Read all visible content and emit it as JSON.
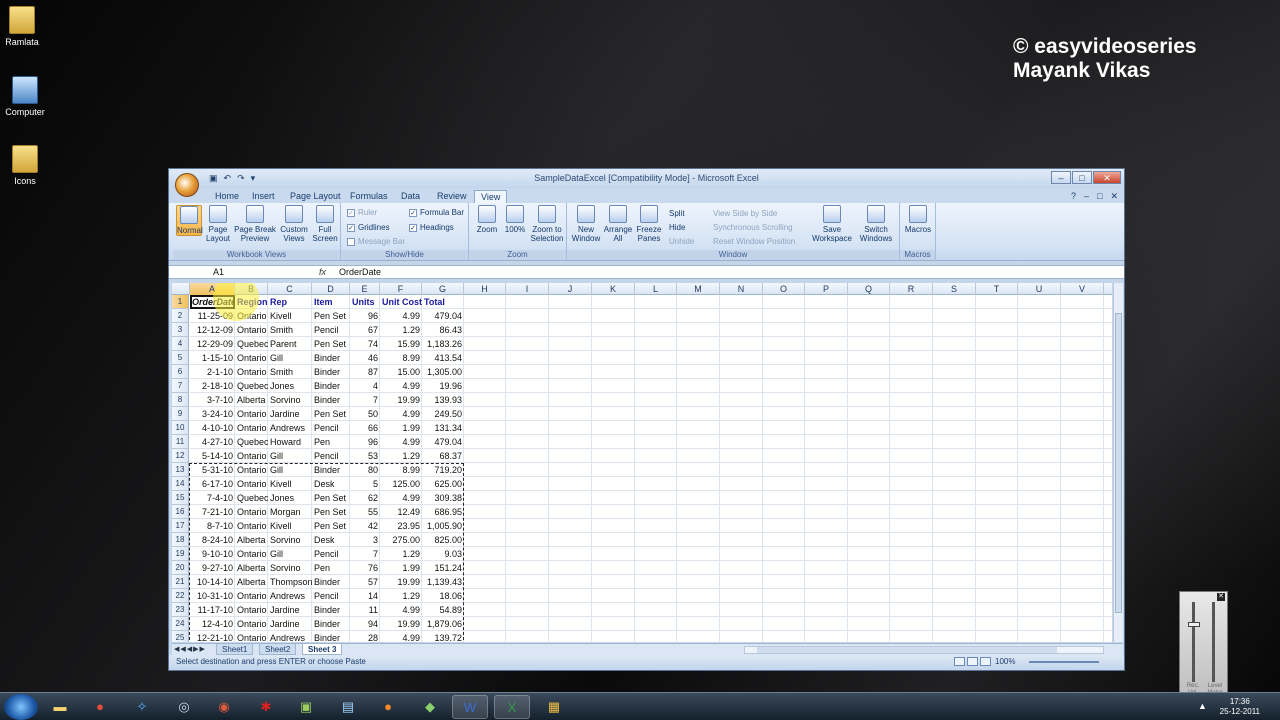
{
  "watermark": {
    "line1": "© easyvideoseries",
    "line2": "Mayank Vikas"
  },
  "desktop_icons": [
    {
      "label": "Ramlata"
    },
    {
      "label": "Computer"
    },
    {
      "label": "Icons"
    }
  ],
  "window": {
    "title": "SampleDataExcel  [Compatibility Mode] - Microsoft Excel",
    "controls": {
      "min": "–",
      "max": "□",
      "close": "✕"
    }
  },
  "ribbon": {
    "tabs": [
      "Home",
      "Insert",
      "Page Layout",
      "Formulas",
      "Data",
      "Review",
      "View"
    ],
    "active_tab": "View",
    "groups": {
      "workbook_views": {
        "caption": "Workbook Views",
        "buttons": [
          "Normal",
          "Page Layout",
          "Page Break Preview",
          "Custom Views",
          "Full Screen"
        ]
      },
      "show_hide": {
        "caption": "Show/Hide",
        "ruler": "Ruler",
        "gridlines": "Gridlines",
        "message_bar": "Message Bar",
        "formula_bar": "Formula Bar",
        "headings": "Headings"
      },
      "zoom": {
        "caption": "Zoom",
        "buttons": [
          "Zoom",
          "100%",
          "Zoom to Selection"
        ]
      },
      "window": {
        "caption": "Window",
        "buttons": [
          "New Window",
          "Arrange All",
          "Freeze Panes"
        ],
        "small": [
          "Split",
          "Hide",
          "Unhide"
        ],
        "dim": [
          "View Side by Side",
          "Synchronous Scrolling",
          "Reset Window Position"
        ],
        "save_workspace": "Save Workspace",
        "switch_windows": "Switch Windows"
      },
      "macros": {
        "caption": "Macros",
        "button": "Macros"
      }
    }
  },
  "formula_bar": {
    "name_box": "A1",
    "fx": "fx",
    "value": "OrderDate"
  },
  "columns": [
    "A",
    "B",
    "C",
    "D",
    "E",
    "F",
    "G",
    "H",
    "I",
    "J",
    "K",
    "L",
    "M",
    "N",
    "O",
    "P",
    "Q",
    "R",
    "S",
    "T",
    "U",
    "V"
  ],
  "headers": [
    "OrderDate",
    "Region",
    "Rep",
    "Item",
    "Units",
    "Unit Cost",
    "Total"
  ],
  "rows": [
    [
      "11-25-09",
      "Ontario",
      "Kivell",
      "Pen Set",
      "96",
      "4.99",
      "479.04"
    ],
    [
      "12-12-09",
      "Ontario",
      "Smith",
      "Pencil",
      "67",
      "1.29",
      "86.43"
    ],
    [
      "12-29-09",
      "Quebec",
      "Parent",
      "Pen Set",
      "74",
      "15.99",
      "1,183.26"
    ],
    [
      "1-15-10",
      "Ontario",
      "Gill",
      "Binder",
      "46",
      "8.99",
      "413.54"
    ],
    [
      "2-1-10",
      "Ontario",
      "Smith",
      "Binder",
      "87",
      "15.00",
      "1,305.00"
    ],
    [
      "2-18-10",
      "Quebec",
      "Jones",
      "Binder",
      "4",
      "4.99",
      "19.96"
    ],
    [
      "3-7-10",
      "Alberta",
      "Sorvino",
      "Binder",
      "7",
      "19.99",
      "139.93"
    ],
    [
      "3-24-10",
      "Ontario",
      "Jardine",
      "Pen Set",
      "50",
      "4.99",
      "249.50"
    ],
    [
      "4-10-10",
      "Ontario",
      "Andrews",
      "Pencil",
      "66",
      "1.99",
      "131.34"
    ],
    [
      "4-27-10",
      "Quebec",
      "Howard",
      "Pen",
      "96",
      "4.99",
      "479.04"
    ],
    [
      "5-14-10",
      "Ontario",
      "Gill",
      "Pencil",
      "53",
      "1.29",
      "68.37"
    ],
    [
      "5-31-10",
      "Ontario",
      "Gill",
      "Binder",
      "80",
      "8.99",
      "719.20"
    ],
    [
      "6-17-10",
      "Ontario",
      "Kivell",
      "Desk",
      "5",
      "125.00",
      "625.00"
    ],
    [
      "7-4-10",
      "Quebec",
      "Jones",
      "Pen Set",
      "62",
      "4.99",
      "309.38"
    ],
    [
      "7-21-10",
      "Ontario",
      "Morgan",
      "Pen Set",
      "55",
      "12.49",
      "686.95"
    ],
    [
      "8-7-10",
      "Ontario",
      "Kivell",
      "Pen Set",
      "42",
      "23.95",
      "1,005.90"
    ],
    [
      "8-24-10",
      "Alberta",
      "Sorvino",
      "Desk",
      "3",
      "275.00",
      "825.00"
    ],
    [
      "9-10-10",
      "Ontario",
      "Gill",
      "Pencil",
      "7",
      "1.29",
      "9.03"
    ],
    [
      "9-27-10",
      "Alberta",
      "Sorvino",
      "Pen",
      "76",
      "1.99",
      "151.24"
    ],
    [
      "10-14-10",
      "Alberta",
      "Thompson",
      "Binder",
      "57",
      "19.99",
      "1,139.43"
    ],
    [
      "10-31-10",
      "Ontario",
      "Andrews",
      "Pencil",
      "14",
      "1.29",
      "18.06"
    ],
    [
      "11-17-10",
      "Ontario",
      "Jardine",
      "Binder",
      "11",
      "4.99",
      "54.89"
    ],
    [
      "12-4-10",
      "Ontario",
      "Jardine",
      "Binder",
      "94",
      "19.99",
      "1,879.06"
    ],
    [
      "12-21-10",
      "Ontario",
      "Andrews",
      "Binder",
      "28",
      "4.99",
      "139.72"
    ]
  ],
  "sheets": [
    "Sheet1",
    "Sheet2",
    "Sheet 3"
  ],
  "active_sheet": "Sheet 3",
  "status": {
    "text": "Select destination and press ENTER or choose Paste",
    "zoom": "100%"
  },
  "taskbar": {
    "time": "17:36",
    "date": "25-12-2011"
  },
  "mixer": {
    "left_label": "Rec. Vol.",
    "right_label": "Level Meter"
  }
}
